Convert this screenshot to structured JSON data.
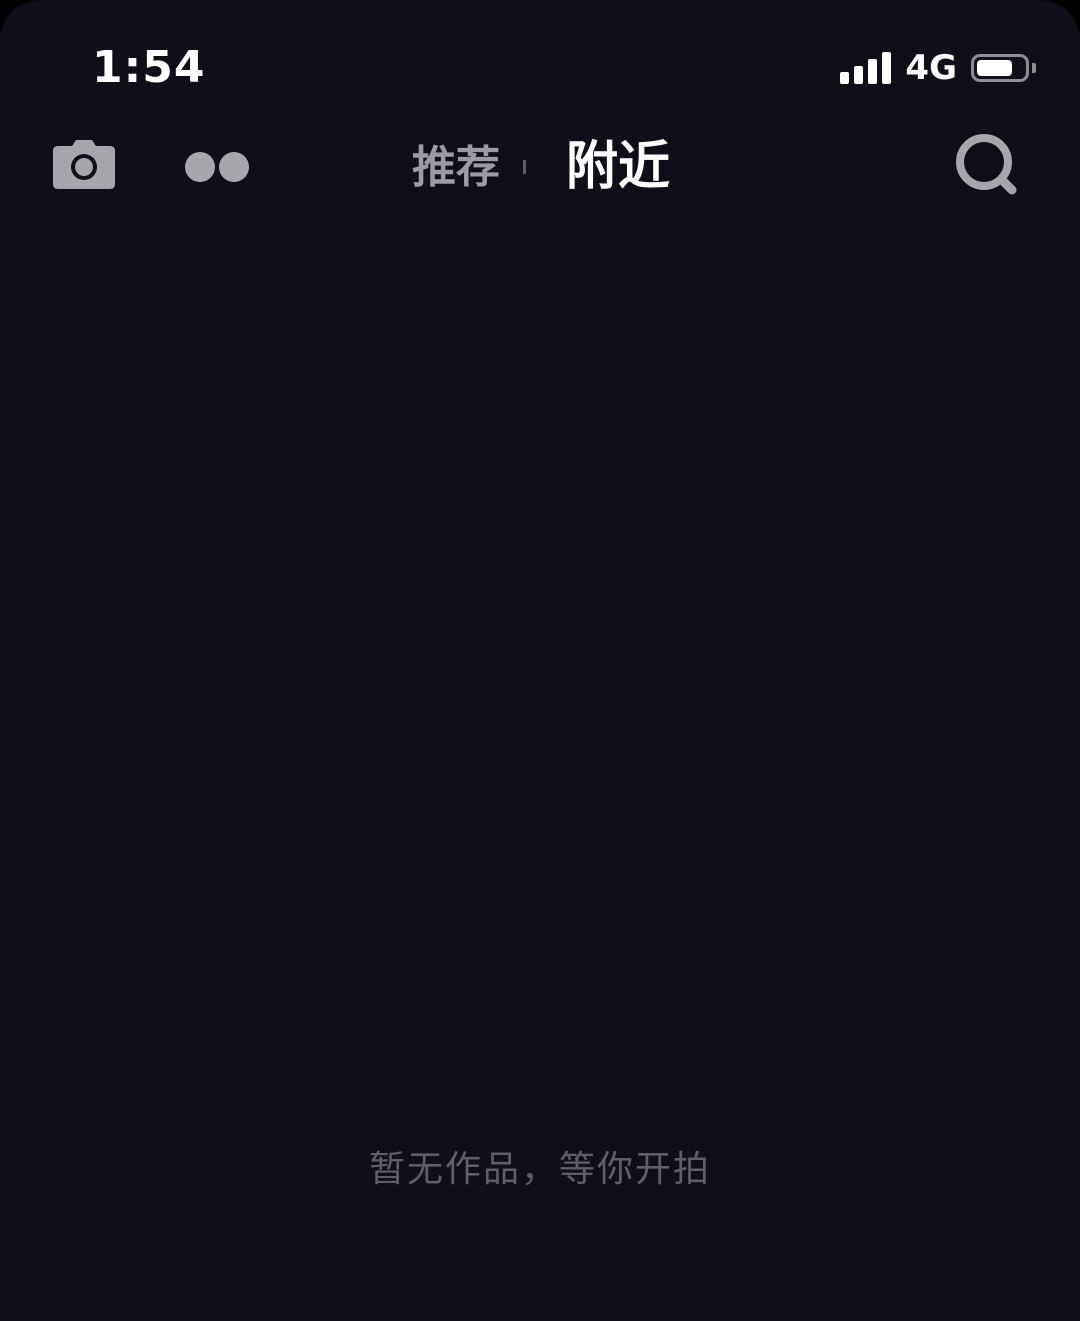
{
  "status_bar": {
    "time": "1:54",
    "network": "4G",
    "signal_bars": 4,
    "battery_level": 0.75
  },
  "nav": {
    "camera_icon": "camera-icon",
    "dots_icon": "dots-icon",
    "search_icon": "search-icon",
    "tabs": [
      {
        "label": "推荐",
        "active": false
      },
      {
        "label": "附近",
        "active": true
      }
    ]
  },
  "empty_state": {
    "message": "暂无作品，等你开拍"
  },
  "colors": {
    "background": "#0f0f1a",
    "active_tab": "#ffffff",
    "inactive_tab": "#9b9ba3",
    "icon": "#a6a6ad",
    "empty_text": "#5e5e68"
  }
}
